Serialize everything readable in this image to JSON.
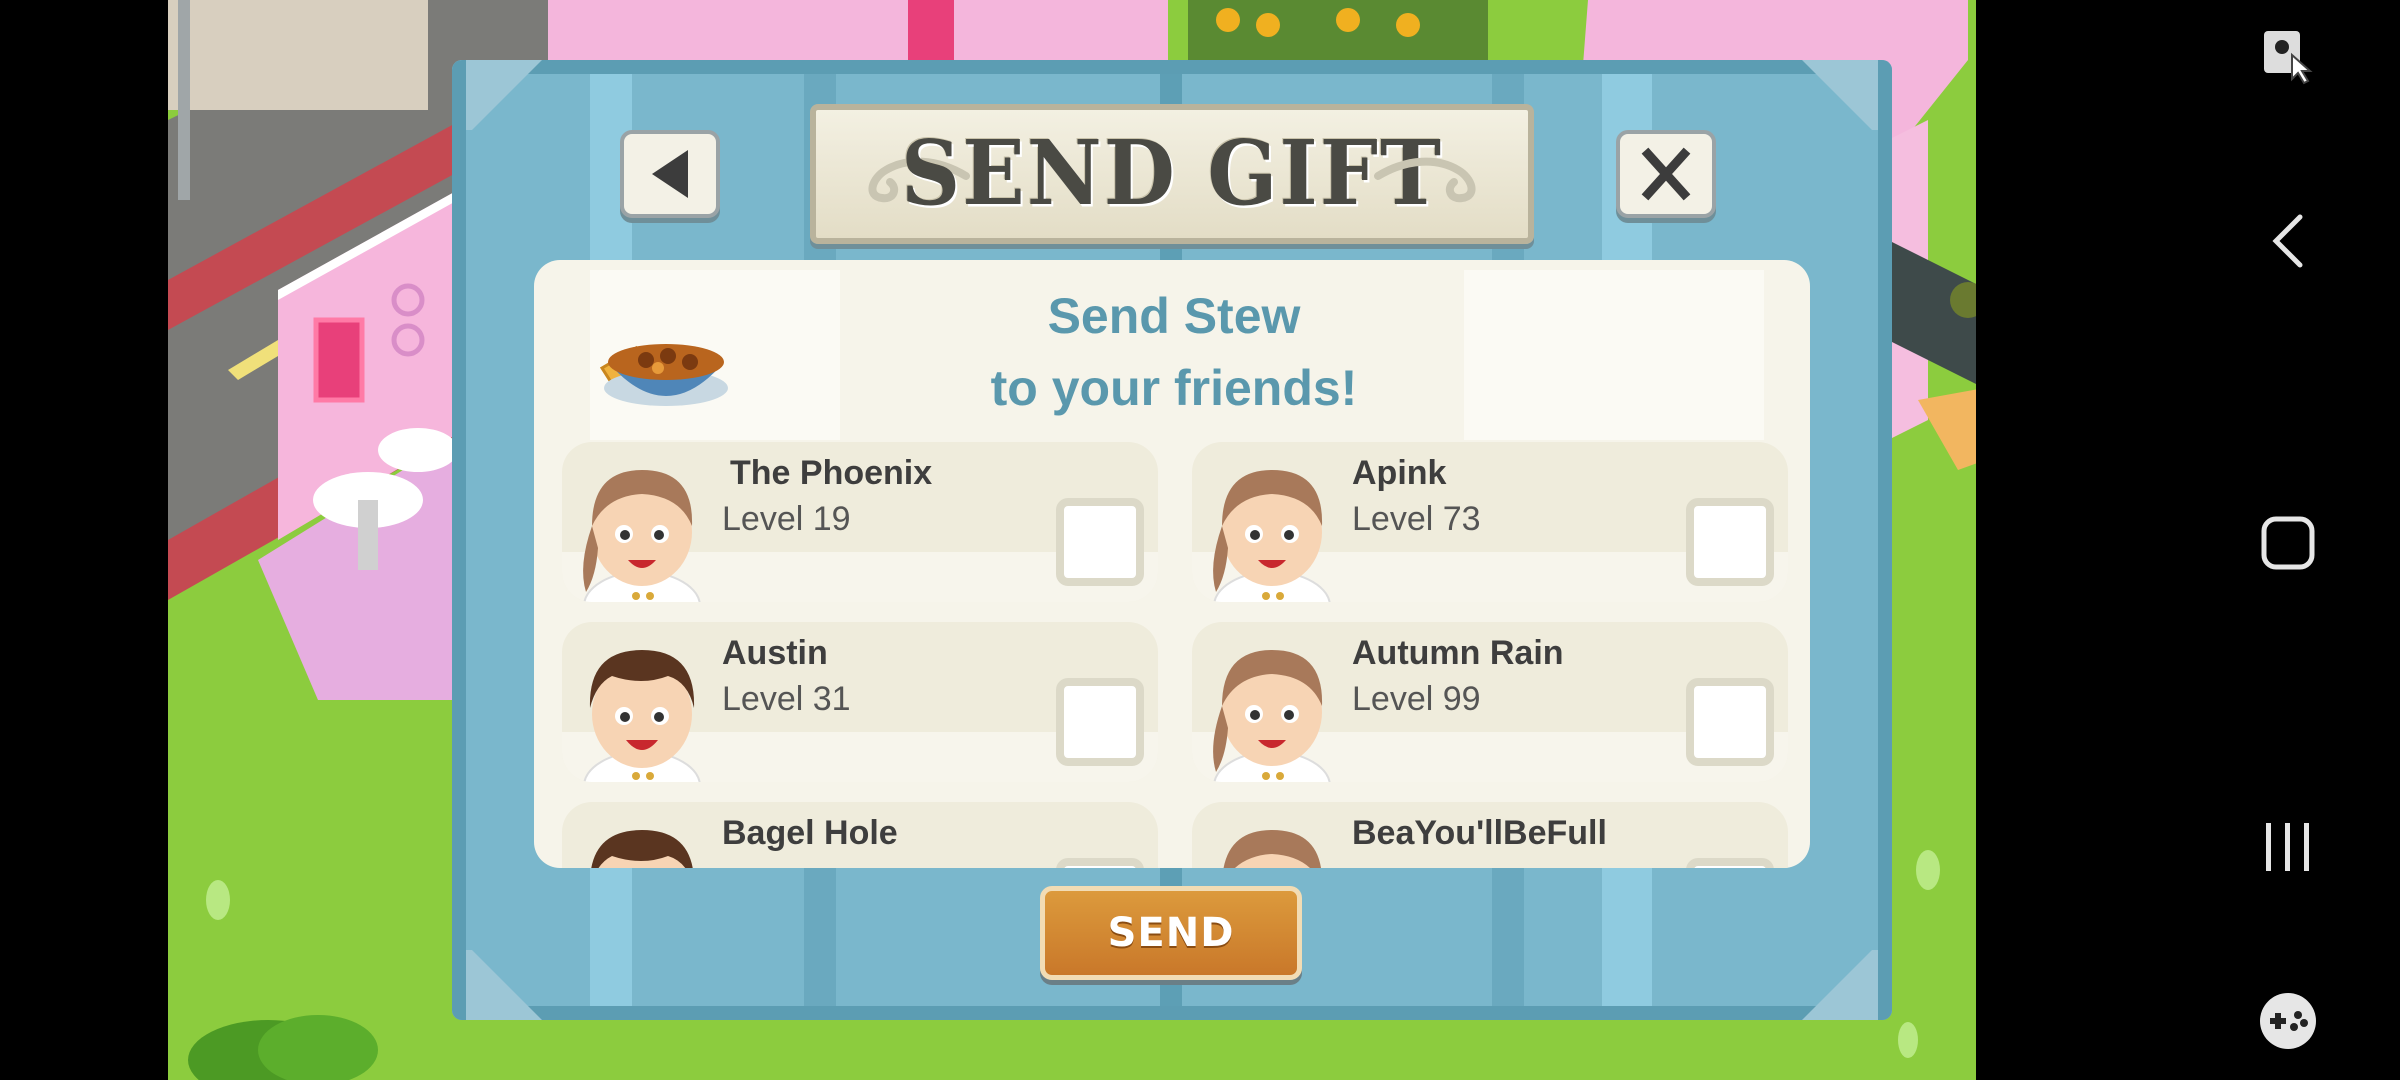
{
  "dialog": {
    "title": "SEND GIFT",
    "heading_line1": "Send Stew",
    "heading_line2": "to your friends!",
    "send_label": "SEND",
    "friends": [
      {
        "name": "The Phoenix",
        "level": "Level 19",
        "avatar": "chef-girl"
      },
      {
        "name": "Apink",
        "level": "Level 73",
        "avatar": "chef-girl"
      },
      {
        "name": "Austin",
        "level": "Level 31",
        "avatar": "chef-boy"
      },
      {
        "name": "Autumn Rain",
        "level": "Level 99",
        "avatar": "chef-girl"
      },
      {
        "name": "Bagel Hole",
        "level": "",
        "avatar": "chef-boy"
      },
      {
        "name": "BeaYou'llBeFull",
        "level": "",
        "avatar": "chef-girl"
      }
    ]
  },
  "icons": {
    "back": "triangle-left-icon",
    "close": "x-icon",
    "gift_item": "stew-bowl-icon"
  },
  "system_nav": [
    "screen-lock-icon",
    "back-chevron-icon",
    "home-square-icon",
    "recents-icon",
    "game-tools-icon"
  ],
  "colors": {
    "frame": "#7ab7cc",
    "heading": "#5a98ad",
    "send_button": "#d0842f",
    "panel": "#f6f4ea"
  }
}
